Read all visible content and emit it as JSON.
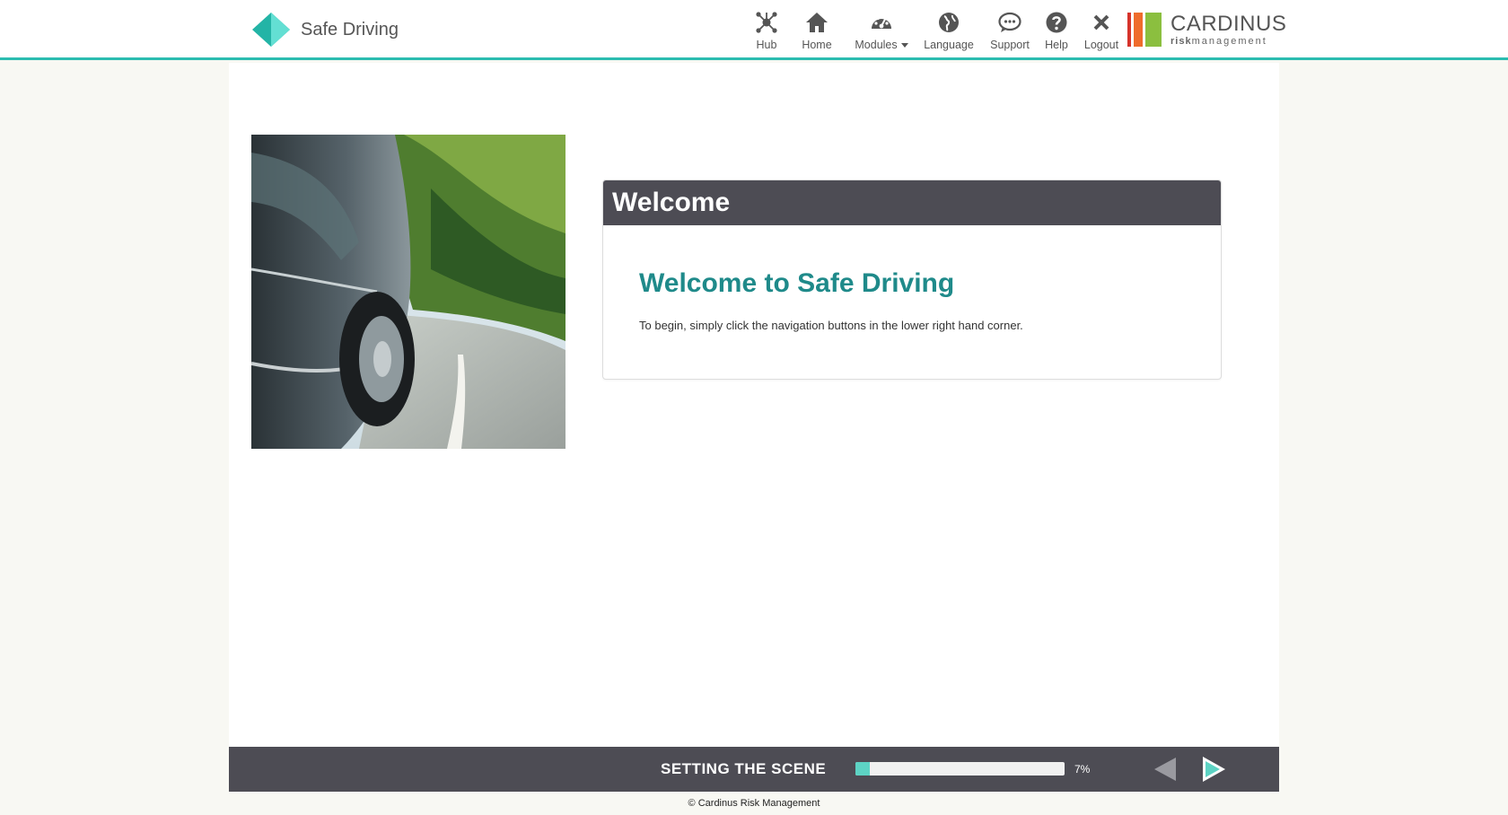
{
  "brand": {
    "name": "Safe Driving"
  },
  "nav": [
    {
      "label": "Hub",
      "icon": "hub-icon"
    },
    {
      "label": "Home",
      "icon": "home-icon"
    },
    {
      "label": "Modules",
      "icon": "dashboard-icon"
    },
    {
      "label": "Language",
      "icon": "globe-icon"
    },
    {
      "label": "Support",
      "icon": "chat-icon"
    },
    {
      "label": "Help",
      "icon": "question-icon"
    },
    {
      "label": "Logout",
      "icon": "close-icon"
    }
  ],
  "partner_logo": {
    "name": "CARDINUS",
    "tagline_bold": "risk",
    "tagline": "management"
  },
  "card": {
    "header": "Welcome",
    "title": "Welcome to Safe Driving",
    "text": "To begin, simply click the navigation buttons in the lower right hand corner."
  },
  "bottom_bar": {
    "section": "SETTING THE SCENE",
    "progress": 7,
    "progress_label": "7%"
  },
  "footer": {
    "text": "Cardinus Risk Management",
    "symbol": "©"
  },
  "colors": {
    "accent": "#2bbcb0",
    "heading": "#1f8a8a",
    "bar": "#4d4c54"
  }
}
